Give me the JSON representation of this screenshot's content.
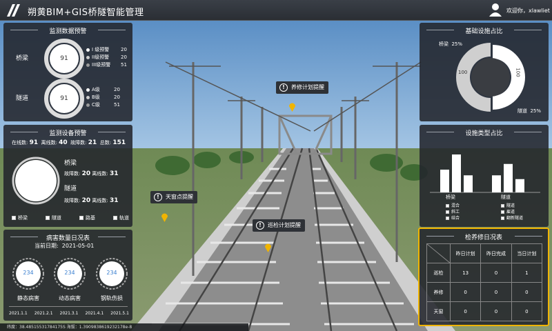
{
  "header": {
    "title": "朔黄BIM+GIS桥隧智能管理",
    "welcome": "欢迎你，xlawliet"
  },
  "monitor_warning": {
    "title": "监测数据预警",
    "bridge": {
      "label": "桥梁",
      "total": "91",
      "items": [
        {
          "label": "I 级预警",
          "value": "20"
        },
        {
          "label": "II级预警",
          "value": "20"
        },
        {
          "label": "III级预警",
          "value": "51"
        }
      ]
    },
    "tunnel": {
      "label": "隧道",
      "total": "91",
      "items": [
        {
          "label": "A级",
          "value": "20"
        },
        {
          "label": "B级",
          "value": "20"
        },
        {
          "label": "C级",
          "value": "51"
        }
      ]
    }
  },
  "device_warning": {
    "title": "监测设备预警",
    "stats": [
      {
        "label": "在线数:",
        "value": "91"
      },
      {
        "label": "离线数:",
        "value": "40"
      },
      {
        "label": "故障数:",
        "value": "21"
      },
      {
        "label": "总数:",
        "value": "151"
      }
    ],
    "bridge": {
      "label": "桥梁",
      "fault_label": "故障数:",
      "fault": "20",
      "offline_label": "离线数:",
      "offline": "31"
    },
    "tunnel": {
      "label": "隧道",
      "fault_label": "故障数:",
      "fault": "20",
      "offline_label": "离线数:",
      "offline": "31"
    },
    "legend": [
      "桥梁",
      "隧道",
      "路基",
      "轨道"
    ]
  },
  "defects": {
    "title": "病害数量日况表",
    "date_label": "当前日期:",
    "date": "2021-05-01",
    "items": [
      {
        "label": "静态病害",
        "value": "234"
      },
      {
        "label": "动态病害",
        "value": "234"
      },
      {
        "label": "钢轨伤损",
        "value": "234"
      }
    ],
    "timeline": [
      "2021.1.1",
      "2021.2.1",
      "2021.3.1",
      "2021.4.1",
      "2021.5.1"
    ]
  },
  "coords": {
    "text": "纬度：38.48515531784175S    海拔：1.3909838619232178e-8"
  },
  "facility_ratio": {
    "title": "基础设施占比",
    "chart_data": {
      "type": "pie",
      "slices": [
        {
          "name": "桥梁",
          "value": 100,
          "percent": "25%"
        },
        {
          "name": "隧道",
          "value": 100,
          "percent": "25%"
        }
      ]
    },
    "label_bridge": "桥梁",
    "pct_bridge": "25%",
    "label_tunnel": "隧道",
    "pct_tunnel": "25%",
    "value_left": "100",
    "value_right": "100"
  },
  "facility_type": {
    "title": "设施类型占比",
    "chart_data": {
      "type": "bar",
      "categories": [
        "桥梁",
        "隧道"
      ],
      "series": [
        {
          "name": "混合",
          "values": [
            0.6,
            0.45
          ]
        },
        {
          "name": "斜工",
          "values": [
            1.0,
            0.75
          ]
        },
        {
          "name": "结合",
          "values": [
            0.45,
            0.35
          ]
        }
      ]
    },
    "groups": [
      "桥梁",
      "隧道"
    ],
    "legend_left": [
      "混合",
      "斜工",
      "结合"
    ],
    "legend_right": [
      "隧道",
      "雇道",
      "翻新隧道"
    ]
  },
  "inspection": {
    "title": "检养修日况表",
    "headers": [
      "昨日计划",
      "昨日完成",
      "当日计划"
    ],
    "rows": [
      {
        "label": "巡检",
        "values": [
          "13",
          "0",
          "1"
        ]
      },
      {
        "label": "养修",
        "values": [
          "0",
          "0",
          "0"
        ]
      },
      {
        "label": "天窗",
        "values": [
          "0",
          "0",
          "0"
        ]
      }
    ]
  },
  "markers": [
    {
      "label": "养修计划提醒"
    },
    {
      "label": "天窗点提醒"
    },
    {
      "label": "巡检计划提醒"
    }
  ],
  "colors": {
    "accent": "#f0b400",
    "panel": "#23262c",
    "blue_value": "#3a7fd0"
  }
}
